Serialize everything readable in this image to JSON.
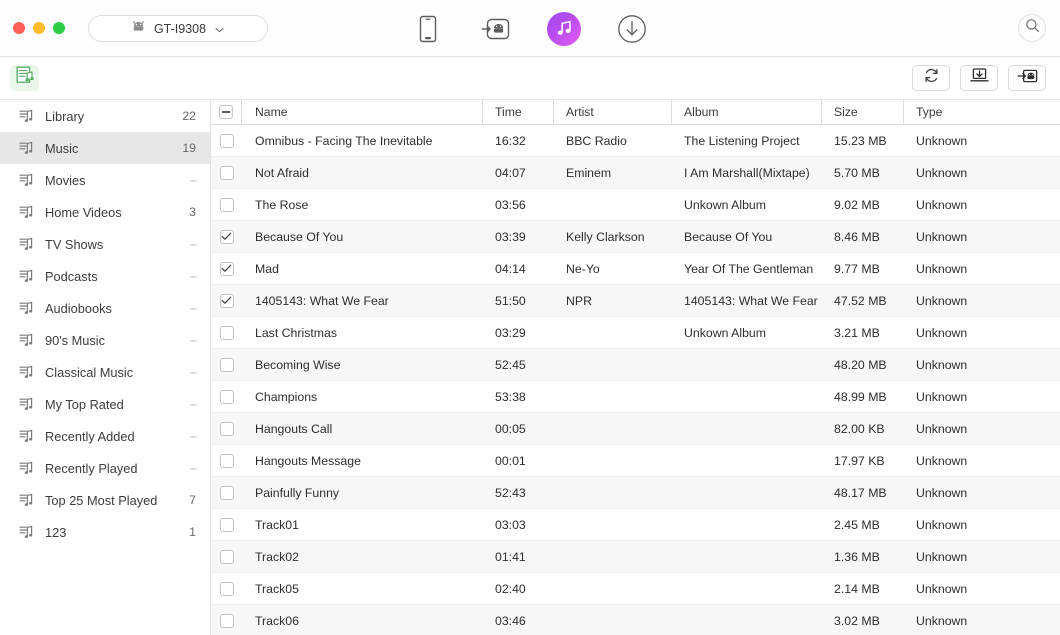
{
  "window": {
    "traffic_lights": [
      "close",
      "minimize",
      "maximize"
    ],
    "colors": {
      "close": "#ff5f57",
      "minimize": "#febc2e",
      "maximize": "#2ace42",
      "accent": "#b44bf0",
      "selected_row": "#e7e7e7"
    }
  },
  "device": {
    "name": "GT-I9308",
    "icon": "android-robot-icon",
    "chevron": "chevron-down-icon"
  },
  "tabs": [
    {
      "id": "device",
      "icon": "phone-icon",
      "active": false
    },
    {
      "id": "transfer",
      "icon": "transfer-to-android-icon",
      "active": false
    },
    {
      "id": "music",
      "icon": "music-note-icon",
      "active": true
    },
    {
      "id": "download",
      "icon": "download-circle-icon",
      "active": false
    }
  ],
  "search": {
    "icon": "search-icon"
  },
  "subtoolbar": {
    "playlist_tab_icon": "playlist-icon",
    "actions": [
      {
        "id": "refresh",
        "icon": "refresh-icon"
      },
      {
        "id": "export-to-computer",
        "icon": "export-to-computer-icon"
      },
      {
        "id": "export-to-device",
        "icon": "export-to-device-icon"
      }
    ]
  },
  "sidebar": {
    "items": [
      {
        "label": "Library",
        "count": "22",
        "selected": false
      },
      {
        "label": "Music",
        "count": "19",
        "selected": true
      },
      {
        "label": "Movies",
        "count": "--",
        "selected": false
      },
      {
        "label": "Home Videos",
        "count": "3",
        "selected": false
      },
      {
        "label": "TV Shows",
        "count": "--",
        "selected": false
      },
      {
        "label": "Podcasts",
        "count": "--",
        "selected": false
      },
      {
        "label": "Audiobooks",
        "count": "--",
        "selected": false
      },
      {
        "label": "90's Music",
        "count": "--",
        "selected": false
      },
      {
        "label": "Classical Music",
        "count": "--",
        "selected": false
      },
      {
        "label": "My Top Rated",
        "count": "--",
        "selected": false
      },
      {
        "label": "Recently Added",
        "count": "--",
        "selected": false
      },
      {
        "label": "Recently Played",
        "count": "--",
        "selected": false
      },
      {
        "label": "Top 25 Most Played",
        "count": "7",
        "selected": false
      },
      {
        "label": "123",
        "count": "1",
        "selected": false
      }
    ]
  },
  "table": {
    "select_all_state": "indeterminate",
    "columns": [
      "Name",
      "Time",
      "Artist",
      "Album",
      "Size",
      "Type"
    ],
    "rows": [
      {
        "checked": false,
        "name": "Omnibus - Facing The Inevitable",
        "time": "16:32",
        "artist": "BBC Radio",
        "album": "The Listening Project",
        "size": "15.23 MB",
        "type": "Unknown"
      },
      {
        "checked": false,
        "name": "Not Afraid",
        "time": "04:07",
        "artist": "Eminem",
        "album": "I Am Marshall(Mixtape)",
        "size": "5.70 MB",
        "type": "Unknown"
      },
      {
        "checked": false,
        "name": "The Rose",
        "time": "03:56",
        "artist": "",
        "album": "Unkown Album",
        "size": "9.02 MB",
        "type": "Unknown"
      },
      {
        "checked": true,
        "name": "Because Of You",
        "time": "03:39",
        "artist": "Kelly Clarkson",
        "album": "Because Of You",
        "size": "8.46 MB",
        "type": "Unknown"
      },
      {
        "checked": true,
        "name": "Mad",
        "time": "04:14",
        "artist": "Ne-Yo",
        "album": "Year Of The Gentleman",
        "size": "9.77 MB",
        "type": "Unknown"
      },
      {
        "checked": true,
        "name": "1405143: What We Fear",
        "time": "51:50",
        "artist": "NPR",
        "album": "1405143: What We Fear",
        "size": "47.52 MB",
        "type": "Unknown"
      },
      {
        "checked": false,
        "name": "Last Christmas",
        "time": "03:29",
        "artist": "",
        "album": "Unkown Album",
        "size": "3.21 MB",
        "type": "Unknown"
      },
      {
        "checked": false,
        "name": "Becoming Wise",
        "time": "52:45",
        "artist": "",
        "album": "",
        "size": "48.20 MB",
        "type": "Unknown"
      },
      {
        "checked": false,
        "name": "Champions",
        "time": "53:38",
        "artist": "",
        "album": "",
        "size": "48.99 MB",
        "type": "Unknown"
      },
      {
        "checked": false,
        "name": "Hangouts Call",
        "time": "00:05",
        "artist": "",
        "album": "",
        "size": "82.00 KB",
        "type": "Unknown"
      },
      {
        "checked": false,
        "name": "Hangouts Message",
        "time": "00:01",
        "artist": "",
        "album": "",
        "size": "17.97 KB",
        "type": "Unknown"
      },
      {
        "checked": false,
        "name": "Painfully Funny",
        "time": "52:43",
        "artist": "",
        "album": "",
        "size": "48.17 MB",
        "type": "Unknown"
      },
      {
        "checked": false,
        "name": "Track01",
        "time": "03:03",
        "artist": "",
        "album": "",
        "size": "2.45 MB",
        "type": "Unknown"
      },
      {
        "checked": false,
        "name": "Track02",
        "time": "01:41",
        "artist": "",
        "album": "",
        "size": "1.36 MB",
        "type": "Unknown"
      },
      {
        "checked": false,
        "name": "Track05",
        "time": "02:40",
        "artist": "",
        "album": "",
        "size": "2.14 MB",
        "type": "Unknown"
      },
      {
        "checked": false,
        "name": "Track06",
        "time": "03:46",
        "artist": "",
        "album": "",
        "size": "3.02 MB",
        "type": "Unknown"
      }
    ]
  }
}
